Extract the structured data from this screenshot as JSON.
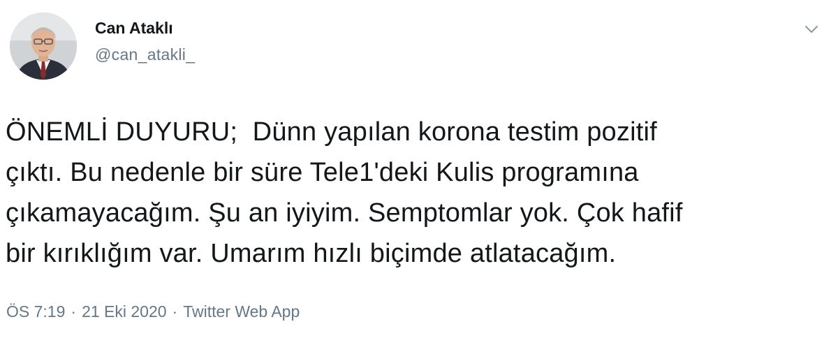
{
  "author": {
    "display_name": "Can Ataklı",
    "handle": "@can_atakli_"
  },
  "tweet": {
    "lines": [
      "ÖNEMLİ DUYURU;  Dünn yapılan korona testim pozitif",
      "çıktı. Bu nedenle bir süre Tele1'deki Kulis programına",
      "çıkamayacağım. Şu an iyiyim. Semptomlar yok. Çok hafif",
      "bir kırıklığım var. Umarım hızlı biçimde atlatacağım."
    ]
  },
  "meta": {
    "time": "ÖS 7:19",
    "separator": "·",
    "date": "21 Eki 2020",
    "source": "Twitter Web App"
  },
  "icons": {
    "menu": "chevron-down-icon",
    "avatar": "profile-photo"
  },
  "colors": {
    "text": "#14171a",
    "secondary": "#657786",
    "background": "#ffffff"
  }
}
